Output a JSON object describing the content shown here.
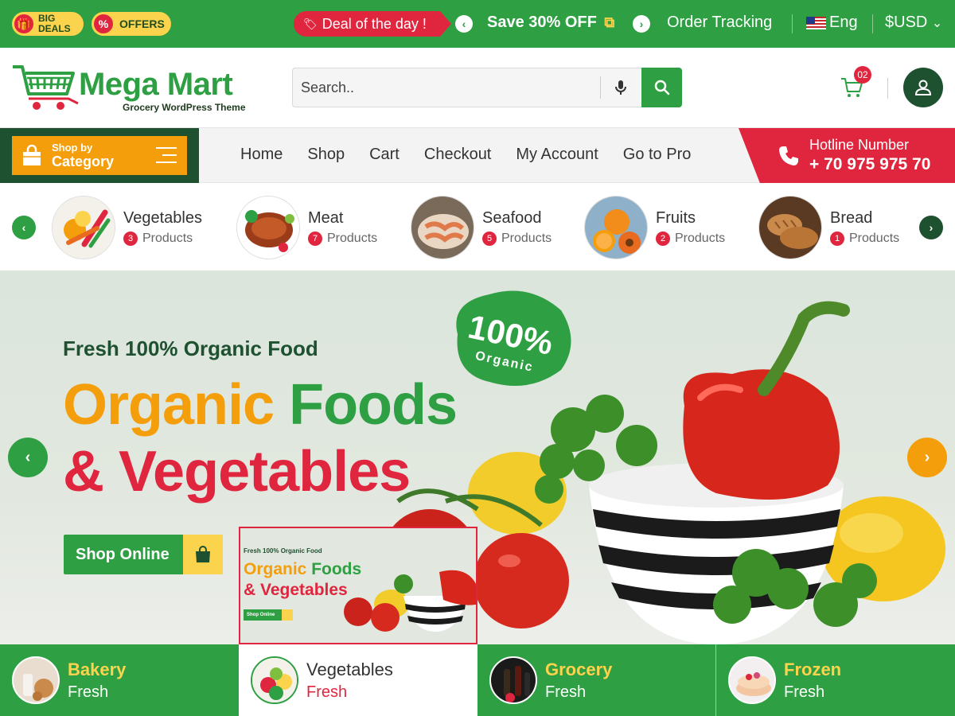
{
  "topbar": {
    "big_deals_line1": "BIG",
    "big_deals_line2": "DEALS",
    "offers_label": "OFFERS",
    "deal_of_day": "Deal of the day !",
    "promo": "Save 30% OFF",
    "order_tracking": "Order Tracking",
    "language": "Eng",
    "currency": "$USD",
    "currency_caret": "⌄"
  },
  "header": {
    "logo_title": "Mega Mart",
    "logo_subtitle": "Grocery WordPress Theme",
    "search_placeholder": "Search..",
    "cart_count": "02"
  },
  "nav": {
    "category_small": "Shop by",
    "category_big": "Category",
    "links": [
      "Home",
      "Shop",
      "Cart",
      "Checkout",
      "My Account",
      "Go to Pro"
    ],
    "hotline_label": "Hotline Number",
    "hotline_number": "+ 70 975 975 70"
  },
  "categories": [
    {
      "name": "Vegetables",
      "count": "3",
      "suffix": "Products"
    },
    {
      "name": "Meat",
      "count": "7",
      "suffix": "Products"
    },
    {
      "name": "Seafood",
      "count": "5",
      "suffix": "Products"
    },
    {
      "name": "Fruits",
      "count": "2",
      "suffix": "Products"
    },
    {
      "name": "Bread",
      "count": "1",
      "suffix": "Products"
    }
  ],
  "hero": {
    "kicker": "Fresh 100% Organic Food",
    "line1_a": "Organic",
    "line1_b": "Foods",
    "line2": "& Vegetables",
    "cta": "Shop Online",
    "stamp_big": "100%",
    "stamp_small": "Organic"
  },
  "preview": {
    "kicker": "Fresh 100% Organic Food",
    "line1_a": "Organic",
    "line1_b": "Foods",
    "line2": "& Vegetables",
    "cta": "Shop Online"
  },
  "tabs": [
    {
      "title": "Bakery",
      "sub": "Fresh"
    },
    {
      "title": "Vegetables",
      "sub": "Fresh"
    },
    {
      "title": "Grocery",
      "sub": "Fresh"
    },
    {
      "title": "Frozen",
      "sub": "Fresh"
    }
  ],
  "colors": {
    "primary_green": "#2ea043",
    "dark_green": "#1e5130",
    "accent_red": "#e0263f",
    "accent_orange": "#f59e0b",
    "accent_yellow": "#fcd34d"
  },
  "icons": {
    "gift": "gift-icon",
    "percent": "percent-icon",
    "tag": "tag-icon",
    "copy": "copy-icon",
    "flag": "us-flag-icon",
    "mic": "microphone-icon",
    "search": "search-icon",
    "cart": "cart-icon",
    "user": "user-icon",
    "bag": "shopping-bag-icon",
    "menu": "hamburger-menu-icon",
    "phone": "phone-icon"
  }
}
